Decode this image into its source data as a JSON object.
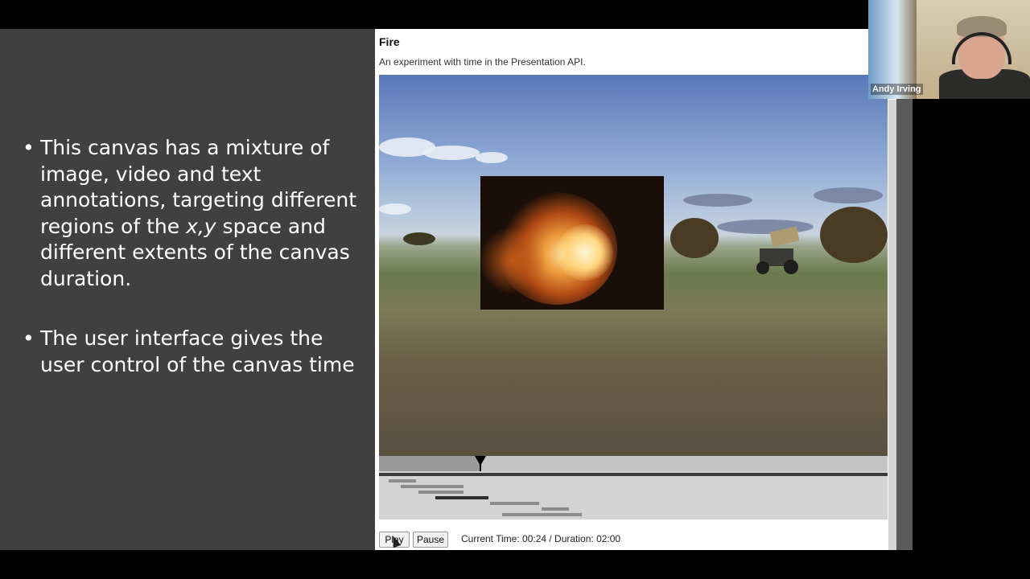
{
  "slide": {
    "bullet1_a": "This canvas has a mixture of image, video and text annotations, targeting different regions of the ",
    "bullet1_xy": "x,y",
    "bullet1_b": " space and different extents of the canvas duration.",
    "bullet2": "The user interface gives the user control of the canvas time"
  },
  "page": {
    "title": "Fire",
    "subtitle": "An experiment with time in the Presentation API."
  },
  "timeline": {
    "current_seconds": 24,
    "duration_seconds": 120
  },
  "controls": {
    "play_label": "Play",
    "pause_label": "Pause",
    "time_text": "Current Time: 00:24 / Duration: 02:00"
  },
  "webcam": {
    "name": "Andy Irving"
  }
}
